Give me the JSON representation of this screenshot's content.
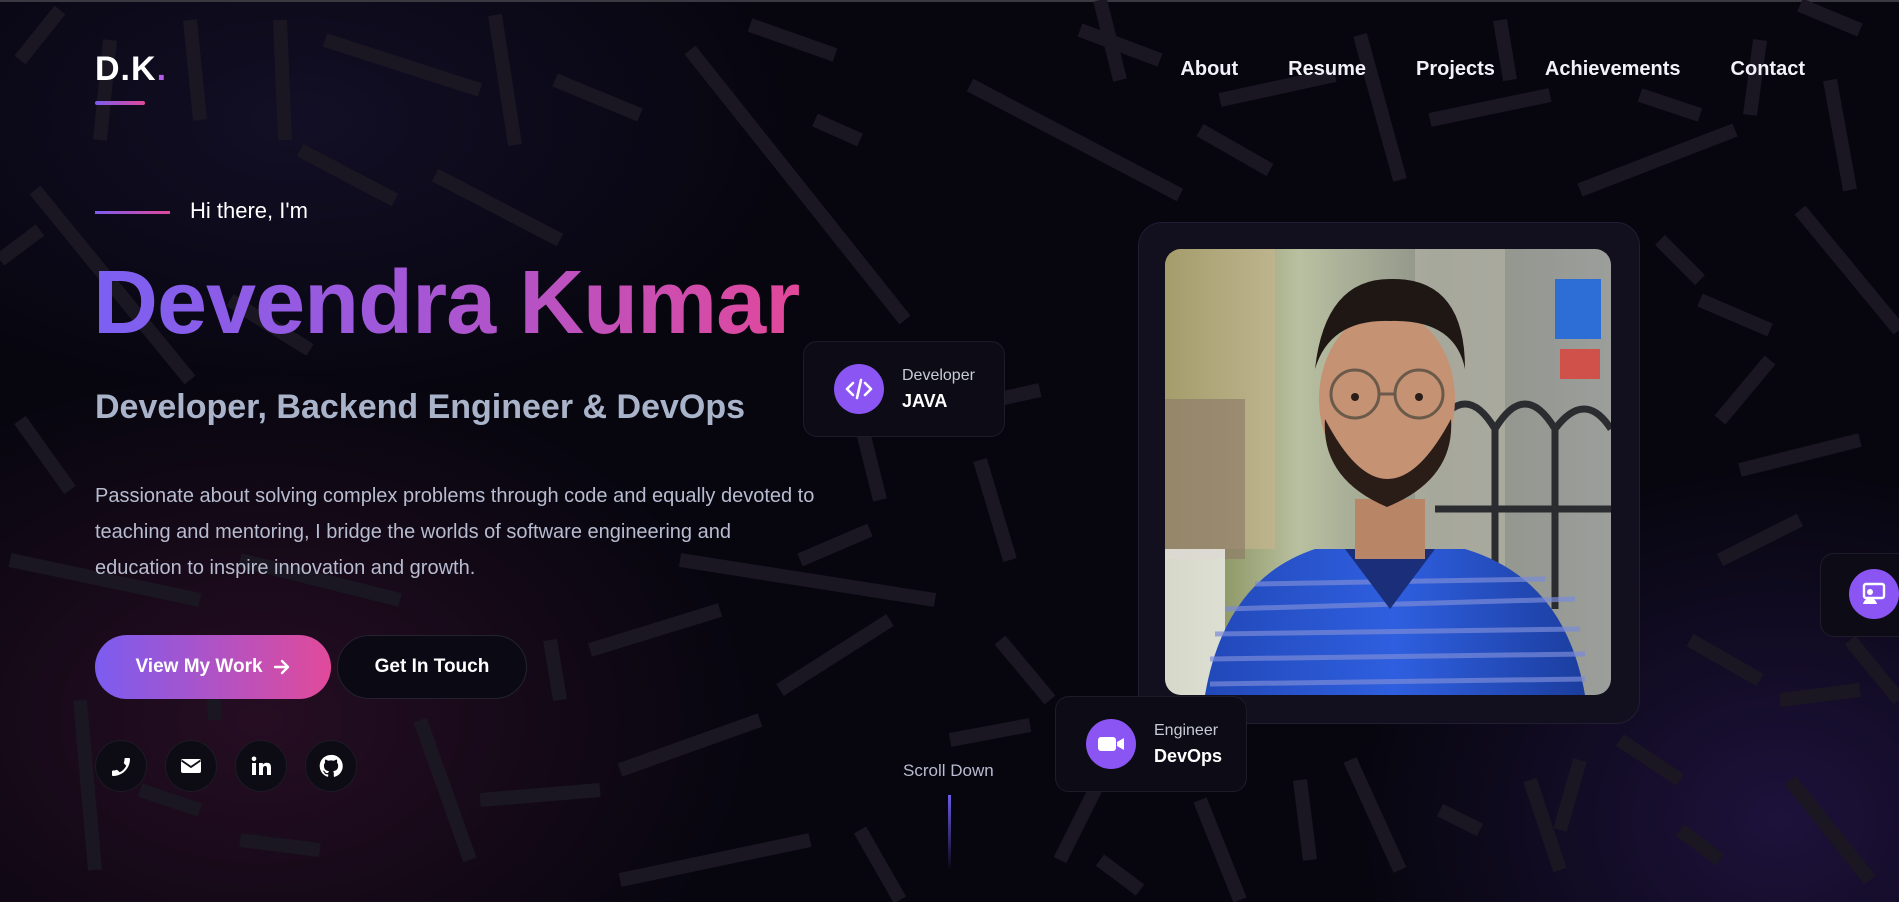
{
  "header": {
    "logo_text": "D.K",
    "logo_dot": ".",
    "nav": [
      "About",
      "Resume",
      "Projects",
      "Achievements",
      "Contact"
    ]
  },
  "hero": {
    "intro": "Hi there, I'm",
    "name": "Devendra Kumar",
    "role": "Developer, Backend Engineer & DevOps",
    "description": "Passionate about solving complex problems through code and equally devoted to teaching and mentoring, I bridge the worlds of software engineering and education to inspire innovation and growth.",
    "primary_button": "View My Work",
    "secondary_button": "Get In Touch"
  },
  "social_icons": [
    "phone-icon",
    "email-icon",
    "linkedin-icon",
    "github-icon"
  ],
  "scroll": {
    "label": "Scroll Down"
  },
  "badges": {
    "developer": {
      "caption": "Developer",
      "value": "JAVA",
      "icon": "code-icon"
    },
    "engineer": {
      "caption": "Engineer",
      "value": "DevOps",
      "icon": "video-camera-icon"
    }
  },
  "side_button": {
    "icon": "presentation-icon"
  },
  "colors": {
    "background": "#07060f",
    "accent_purple": "#7b60f3",
    "accent_pink": "#e2489a",
    "badge_icon": "#8a55f2"
  }
}
